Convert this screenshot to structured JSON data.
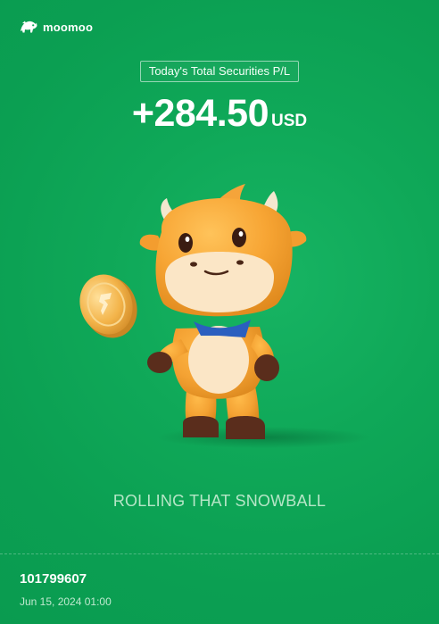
{
  "brand": {
    "logo_icon": "moomoo-bull-logo-icon",
    "name": "moomoo"
  },
  "summary": {
    "label": "Today's Total Securities P/L",
    "amount": "+284.50",
    "currency": "USD"
  },
  "illustration": {
    "name": "moomoo-mascot-with-coin",
    "coin_icon": "coin-icon"
  },
  "slogan": "ROLLING THAT SNOWBALL",
  "footer": {
    "account_id": "101799607",
    "timestamp": "Jun 15, 2024 01:00"
  },
  "colors": {
    "background": "#0fa858",
    "slogan": "#b6e6c7"
  }
}
